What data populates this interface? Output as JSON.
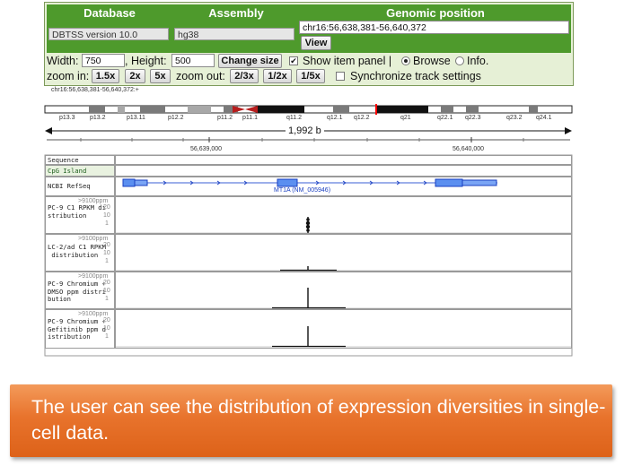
{
  "panel": {
    "headers": {
      "database": "Database",
      "assembly": "Assembly",
      "position": "Genomic position"
    },
    "database_value": "DBTSS version 10.0",
    "assembly_value": "hg38",
    "position_value": "chr16:56,638,381-56,640,372",
    "view_label": "View",
    "width_label": "Width:",
    "width_value": "750",
    "height_label": ", Height:",
    "height_value": "500",
    "change_size_label": "Change size",
    "show_item_panel_label": "Show item panel |",
    "browse_label": "Browse",
    "info_label": "Info.",
    "zoom_in_label": "zoom in:",
    "zoom_in_options": [
      "1.5x",
      "2x",
      "5x"
    ],
    "zoom_out_label": "zoom out:",
    "zoom_out_options": [
      "2/3x",
      "1/2x",
      "1/5x"
    ],
    "sync_label": "Synchronize track settings"
  },
  "ideogram": {
    "location_text": "chr16:56,638,381-56,640,372:+",
    "bands": [
      "p13.3",
      "p13.2",
      "p13.11",
      "p12.2",
      "p11.2",
      "p11.1",
      "q11.2",
      "q12.1",
      "q12.2",
      "q21",
      "q22.1",
      "q22.3",
      "q23.2",
      "q24.1"
    ]
  },
  "ruler": {
    "span_label": "1,992 b",
    "coord_labels": [
      "56,639,000",
      "56,640,000"
    ]
  },
  "tracks": [
    {
      "label": "Sequence"
    },
    {
      "label": "CpG Island"
    },
    {
      "label": "NCBI RefSeq",
      "gene_label": "MT1A (NM_005946)"
    },
    {
      "label": "PC-9 C1 RPKM di\nstribution",
      "scale_top": ">9100ppm",
      "scale_ticks": [
        "20",
        "10",
        "1"
      ]
    },
    {
      "label": "LC-2/ad C1 RPKM\n distribution",
      "scale_top": ">9100ppm",
      "scale_ticks": [
        "20",
        "10",
        "1"
      ]
    },
    {
      "label": "PC-9 Chromium +\nDMSO ppm distri\nbution",
      "scale_top": ">9100ppm",
      "scale_ticks": [
        "20",
        "10",
        "1"
      ]
    },
    {
      "label": "PC-9 Chromium +\nGefitinib ppm d\nistribution",
      "scale_top": ">9100ppm",
      "scale_ticks": [
        "20",
        "10",
        "1"
      ]
    }
  ],
  "caption": "The user can see the distribution of expression diversities in single-cell data.",
  "colors": {
    "header_green": "#4e9a2c",
    "panel_bg": "#e6f0d6",
    "caption_orange": "#e8732c",
    "gene_blue": "#3a5fd6",
    "centromere_red": "#c00000"
  }
}
